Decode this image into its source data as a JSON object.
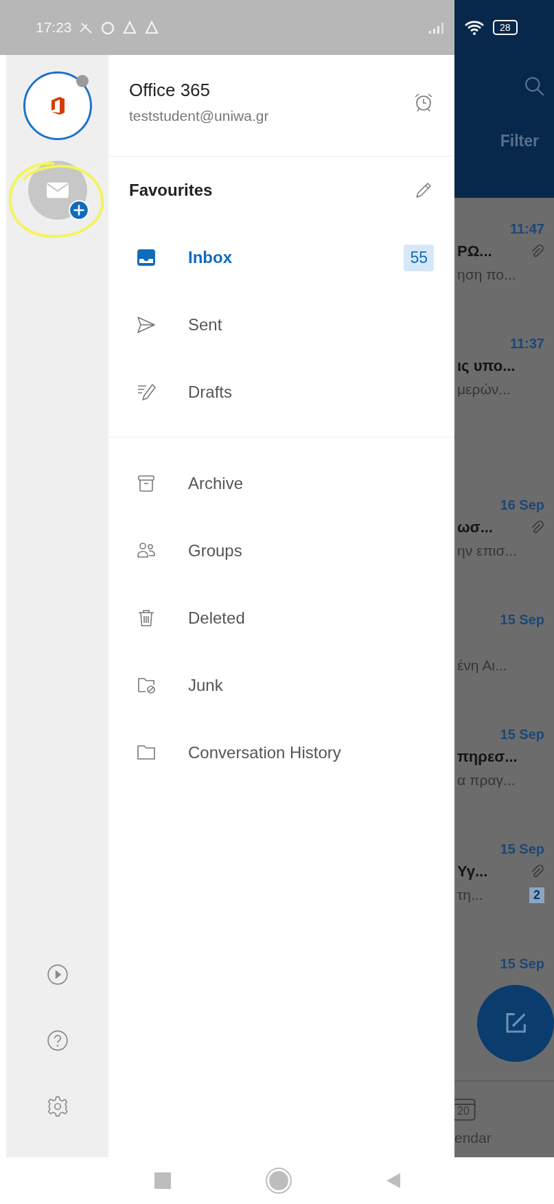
{
  "status_bar": {
    "time": "17:23",
    "battery": "28"
  },
  "accounts": [
    {
      "kind": "office",
      "selected": true
    },
    {
      "kind": "add_mail",
      "selected": false
    }
  ],
  "rail_actions": [
    {
      "kind": "play"
    },
    {
      "kind": "help"
    },
    {
      "kind": "settings"
    }
  ],
  "account": {
    "name": "Office 365",
    "email": "teststudent@uniwa.gr"
  },
  "favourites": {
    "title": "Favourites",
    "folders": [
      {
        "kind": "inbox",
        "label": "Inbox",
        "selected": true,
        "count": "55"
      },
      {
        "kind": "sent",
        "label": "Sent",
        "selected": false
      },
      {
        "kind": "drafts",
        "label": "Drafts",
        "selected": false
      }
    ]
  },
  "folders": [
    {
      "kind": "archive",
      "label": "Archive",
      "selected": false
    },
    {
      "kind": "groups",
      "label": "Groups",
      "selected": false
    },
    {
      "kind": "deleted",
      "label": "Deleted",
      "selected": false
    },
    {
      "kind": "junk",
      "label": "Junk",
      "selected": false
    },
    {
      "kind": "folder",
      "label": "Conversation History",
      "selected": false
    }
  ],
  "background": {
    "filter": "Filter",
    "messages": [
      {
        "time": "11:47",
        "subject": "ΡΩ...",
        "preview": "ηση πο...",
        "attachment": true
      },
      {
        "time": "11:37",
        "subject": "ις υπο...",
        "preview": "μερών...",
        "attachment": false
      },
      {
        "time": "16 Sep",
        "subject": "ωσ...",
        "preview": "ην επισ...",
        "attachment": true
      },
      {
        "time": "15 Sep",
        "preview": "ένη Αι...",
        "attachment": false
      },
      {
        "time": "15 Sep",
        "subject": "πηρεσ...",
        "preview": "α πραγ...",
        "attachment": false
      },
      {
        "time": "15 Sep",
        "subject": "Υγ...",
        "preview": "τη...",
        "attachment": true,
        "count": "2"
      },
      {
        "time": "15 Sep",
        "attachment": false
      }
    ],
    "tab": {
      "label": "endar",
      "day": "20"
    }
  }
}
